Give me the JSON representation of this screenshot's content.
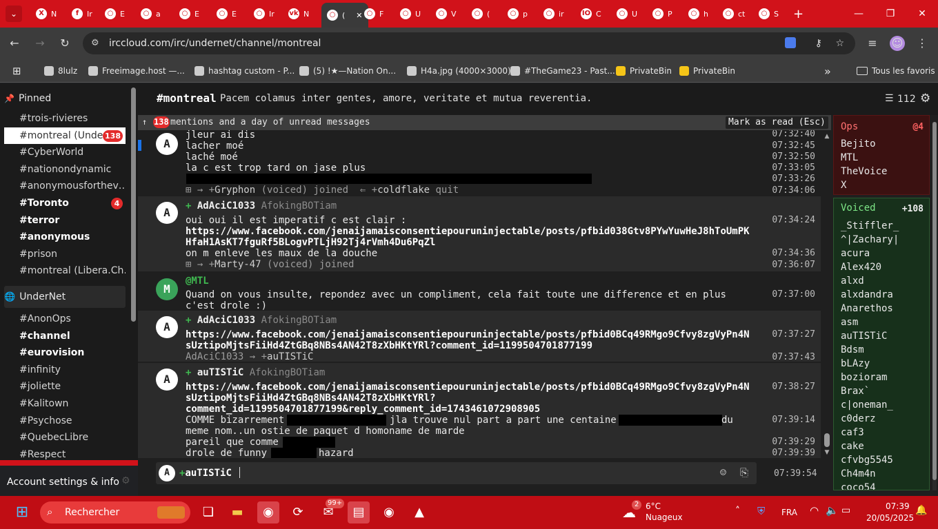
{
  "browser": {
    "tabs": [
      {
        "label": "N",
        "icon": "X"
      },
      {
        "label": "Ir",
        "icon": "f"
      },
      {
        "label": "E",
        "icon": "○"
      },
      {
        "label": "a",
        "icon": "○"
      },
      {
        "label": "E",
        "icon": "○"
      },
      {
        "label": "E",
        "icon": "○"
      },
      {
        "label": "Ir",
        "icon": "○"
      },
      {
        "label": "N",
        "icon": "vk"
      },
      {
        "label": "(",
        "icon": "○"
      },
      {
        "label": "F",
        "icon": "○"
      },
      {
        "label": "U",
        "icon": "○"
      },
      {
        "label": "V",
        "icon": "○"
      },
      {
        "label": "(",
        "icon": "○"
      },
      {
        "label": "p",
        "icon": "○"
      },
      {
        "label": "ir",
        "icon": "○"
      },
      {
        "label": "C",
        "icon": "IO"
      },
      {
        "label": "U",
        "icon": "○"
      },
      {
        "label": "P",
        "icon": "○"
      },
      {
        "label": "h",
        "icon": "○"
      },
      {
        "label": "ct",
        "icon": "○"
      },
      {
        "label": "S",
        "icon": "○"
      }
    ],
    "new_tab": "+",
    "url": "irccloud.com/irc/undernet/channel/montreal",
    "bookmarks": [
      {
        "label": "8lulz"
      },
      {
        "label": "Freeimage.host —..."
      },
      {
        "label": "hashtag custom - P..."
      },
      {
        "label": "(5) !★—Nation On..."
      },
      {
        "label": "H4a.jpg (4000×3000)"
      },
      {
        "label": "#TheGame23 - Past..."
      },
      {
        "label": "PrivateBin"
      },
      {
        "label": "PrivateBin"
      }
    ],
    "bookmarks_more": "»",
    "all_bookmarks": "Tous les favoris"
  },
  "sidebar": {
    "pinned_title": "Pinned",
    "pinned": [
      {
        "name": "#trois-rivieres"
      },
      {
        "name": "#montreal (Unde…",
        "badge": "138"
      },
      {
        "name": "#CyberWorld"
      },
      {
        "name": "#nationondynamic"
      },
      {
        "name": "#anonymousforthev…"
      },
      {
        "name": "#Toronto",
        "badge": "4"
      },
      {
        "name": "#terror"
      },
      {
        "name": "#anonymous"
      },
      {
        "name": "#prison"
      },
      {
        "name": "#montreal (Libera.Ch…"
      }
    ],
    "network_title": "UnderNet",
    "network": [
      {
        "name": "#AnonOps"
      },
      {
        "name": "#channel"
      },
      {
        "name": "#eurovision"
      },
      {
        "name": "#infinity"
      },
      {
        "name": "#joliette"
      },
      {
        "name": "#Kalitown"
      },
      {
        "name": "#Psychose"
      },
      {
        "name": "#QuebecLibre"
      },
      {
        "name": "#Respect"
      }
    ],
    "account": "Account settings & info"
  },
  "channel": {
    "name": "#montreal",
    "topic": "Pacem colamus inter gentes, amore, veritate et mutua reverentia.",
    "member_count": "112",
    "unread_count": "138",
    "unread_text": "mentions and a day of unread messages",
    "mark_read": "Mark as read (Esc)"
  },
  "messages": {
    "b1": {
      "avatar": "A",
      "lines": [
        "jleur ai dis",
        "lacher moé",
        "laché moé",
        "la c est trop tard on jase plus"
      ],
      "times": [
        "07:32:40",
        "07:32:45",
        "07:32:50",
        "07:33:05",
        "07:33:26"
      ]
    },
    "e1": {
      "prefix": "⊞ → +",
      "nick1": "Gryphon",
      "voiced": "voiced",
      "joined": "joined",
      "arrow": "⇐ +",
      "nick2": "coldflake",
      "quit": "quit",
      "time": "07:34:06"
    },
    "b2": {
      "avatar": "A",
      "nick": "AdAciC1033",
      "host": "AfokingBOTiam",
      "lines": [
        "oui oui il est imperatif c est clair :",
        "https://www.facebook.com/jenaijamaisconsentiepouruninjectable/posts/pfbid038Gtv8PYwYuwHeJ8hToUmPK",
        "HfaH1AsKT7fguRf5BLogvPTLjH92Tj4rVmh4Du6PqZl",
        "on m enleve les maux de la douche"
      ],
      "times": [
        "07:34:24",
        "07:34:36"
      ]
    },
    "e2": {
      "prefix": "⊞ → +",
      "nick1": "Marty-47",
      "voiced": "voiced",
      "joined": "joined",
      "time": "07:36:07"
    },
    "b3": {
      "avatar": "M",
      "nick": "@MTL",
      "lines": [
        "Quand on vous insulte, repondez avec un compliment, cela fait toute une difference et en plus",
        "c'est drole :)"
      ],
      "time": "07:37:00"
    },
    "b4": {
      "avatar": "A",
      "nick": "AdAciC1033",
      "host": "AfokingBOTiam",
      "lines": [
        "https://www.facebook.com/jenaijamaisconsentiepouruninjectable/posts/pfbid0BCq49RMgo9Cfvy8zgVyPn4N",
        "sUztipoMjtsFiiHd4ZtGBq8NBs4AN42T8zXbHKtYRl?comment_id=1199504701877199"
      ],
      "time": "07:37:27"
    },
    "e3": {
      "from": "AdAciC1033",
      "arrow": "→ +",
      "to": "auTISTiC",
      "time": "07:37:43"
    },
    "b5": {
      "avatar": "A",
      "nick": "auTISTiC",
      "host": "AfokingBOTiam",
      "lines": [
        "https://www.facebook.com/jenaijamaisconsentiepouruninjectable/posts/pfbid0BCq49RMgo9Cfvy8zgVyPn4N",
        "sUztipoMjtsFiiHd4ZtGBq8NBs4AN42T8zXbHKtYRl?",
        "comment_id=1199504701877199&reply_comment_id=1743461072908905"
      ],
      "line_a1": "COMME bizarrement",
      "line_a2": "jla trouve nul part a part une centaine",
      "line_a3": "du",
      "line_b": "meme nom..un ostie de paquet d homoname de marde",
      "line_c": "pareil que comme",
      "line_d1": "drole de funny",
      "line_d2": "hazard",
      "times": [
        "07:38:27",
        "07:39:14",
        "07:39:29",
        "07:39:39"
      ]
    }
  },
  "input": {
    "avatar": "A",
    "nick": "auTISTiC",
    "time": "07:39:54"
  },
  "members": {
    "ops_title": "Ops",
    "ops_count": "@4",
    "ops": [
      "Bejito",
      "MTL",
      "TheVoice",
      "X"
    ],
    "voiced_title": "Voiced",
    "voiced_count": "+108",
    "voiced": [
      "_Stiffler_",
      "^|Zachary|",
      "acura",
      "Alex420",
      "alxd",
      "alxdandra",
      "Anarethos",
      "asm",
      "auTISTiC",
      "Bdsm",
      "bLAzy",
      "bozioram",
      "Brax`",
      "c|oneman_",
      "c0derz",
      "caf3",
      "cake",
      "cfvbg5545",
      "Ch4m4n",
      "coco54"
    ]
  },
  "taskbar": {
    "search": "Rechercher",
    "weather_badge": "2",
    "weather_temp": "6°C",
    "weather_text": "Nuageux",
    "mail_badge": "99+",
    "lang": "FRA",
    "time": "07:39",
    "date": "20/05/2025"
  },
  "colors": {
    "brand": "#d1121a",
    "ops_bg": "#3b1111",
    "voiced_bg": "#17301b",
    "voiced_plus": "#3fb950"
  }
}
